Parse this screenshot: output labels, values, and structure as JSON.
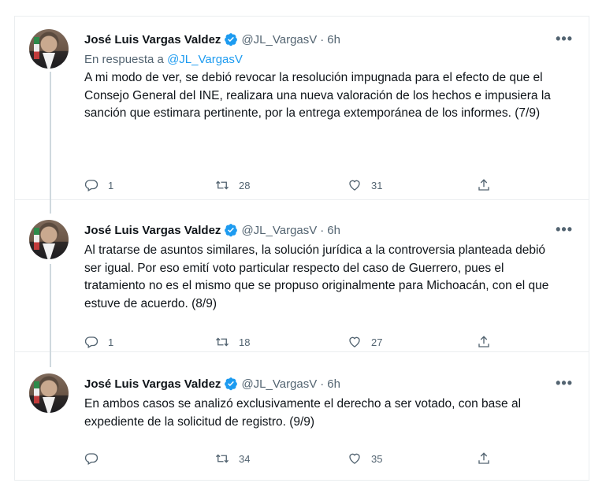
{
  "tweets": [
    {
      "name": "José Luis Vargas Valdez",
      "handle": "@JL_VargasV",
      "dot": "·",
      "time": "6h",
      "more": "•••",
      "reply_prefix": "En respuesta a",
      "reply_handle": "@JL_VargasV",
      "text": "A mi modo de ver, se debió revocar la resolución impugnada para el efecto de que el Consejo General del INE, realizara una nueva valoración de los hechos e impusiera la sanción que estimara pertinente, por la entrega extemporánea de los informes. (7/9)",
      "replies": "1",
      "retweets": "28",
      "likes": "31"
    },
    {
      "name": "José Luis Vargas Valdez",
      "handle": "@JL_VargasV",
      "dot": "·",
      "time": "6h",
      "more": "•••",
      "text": "Al tratarse de asuntos similares, la solución jurídica a la controversia planteada debió ser igual. Por eso emití voto particular respecto del caso de Guerrero, pues el tratamiento no es el mismo que se propuso originalmente para Michoacán, con el que estuve de acuerdo. (8/9)",
      "replies": "1",
      "retweets": "18",
      "likes": "27"
    },
    {
      "name": "José Luis Vargas Valdez",
      "handle": "@JL_VargasV",
      "dot": "·",
      "time": "6h",
      "more": "•••",
      "text": "En ambos casos se analizó exclusivamente el derecho a ser votado, con base al expediente de la solicitud de registro. (9/9)",
      "replies": "",
      "retweets": "34",
      "likes": "35"
    }
  ],
  "colors": {
    "accent": "#1d9bf0",
    "text": "#0f1419",
    "secondary": "#536471",
    "thread_line": "#cfd9de",
    "border": "#ebeef0"
  },
  "icons": [
    "verified-badge-icon",
    "more-icon",
    "reply-icon",
    "retweet-icon",
    "like-icon",
    "share-icon"
  ]
}
